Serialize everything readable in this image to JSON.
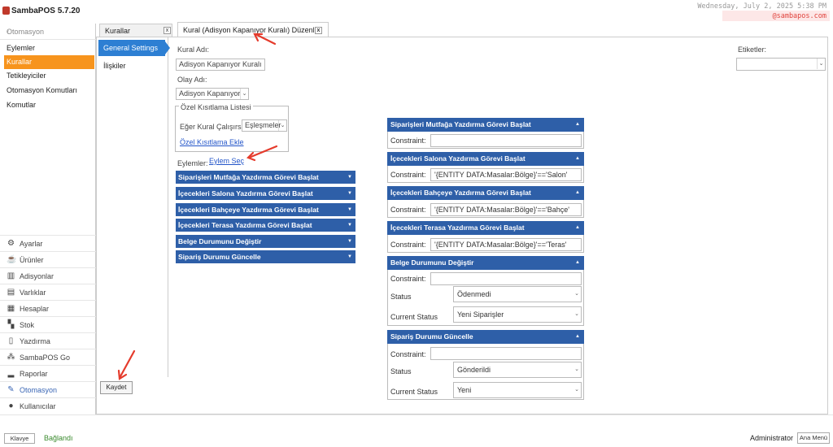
{
  "app": {
    "title": "SambaPOS 5.7.20"
  },
  "header": {
    "datetime": "Wednesday, July 2, 2025 5:38 PM",
    "watermark": "@sambapos.com"
  },
  "sidebar": {
    "header": "Otomasyon",
    "collapse_glyph": "‹",
    "items": [
      {
        "label": "Eylemler",
        "active": false
      },
      {
        "label": "Kurallar",
        "active": true
      },
      {
        "label": "Tetikleyiciler",
        "active": false
      },
      {
        "label": "Otomasyon Komutları",
        "active": false
      },
      {
        "label": "Komutlar",
        "active": false
      }
    ],
    "bottom": [
      {
        "label": "Ayarlar",
        "icon": "gear-icon"
      },
      {
        "label": "Ürünler",
        "icon": "cup-icon"
      },
      {
        "label": "Adisyonlar",
        "icon": "books-icon"
      },
      {
        "label": "Varlıklar",
        "icon": "list-icon"
      },
      {
        "label": "Hesaplar",
        "icon": "calculator-icon"
      },
      {
        "label": "Stok",
        "icon": "boxes-icon"
      },
      {
        "label": "Yazdırma",
        "icon": "document-icon"
      },
      {
        "label": "SambaPOS Go",
        "icon": "network-icon"
      },
      {
        "label": "Raporlar",
        "icon": "bar-chart-icon"
      },
      {
        "label": "Otomasyon",
        "icon": "pen-icon",
        "active": true
      },
      {
        "label": "Kullanıcılar",
        "icon": "user-icon"
      }
    ]
  },
  "tabs": {
    "outer": "Kurallar",
    "inner": "Kural (Adisyon Kapanıyor Kuralı) Düzenle",
    "close_glyph": "x"
  },
  "settings_nav": {
    "general": "General Settings",
    "relations": "İlişkiler"
  },
  "form": {
    "rule_name_label": "Kural Adı:",
    "rule_name_value": "Adisyon Kapanıyor Kuralı",
    "event_label": "Olay Adı:",
    "event_value": "Adisyon Kapanıyor",
    "constraint_list_label": "Özel Kısıtlama Listesi",
    "run_if_label": "Eğer Kural Çalışırsa",
    "run_if_value": "Eşleşmeler",
    "add_constraint_link": "Özel Kısıtlama Ekle",
    "actions_label": "Eylemler:",
    "select_action_link": "Eylem Seç",
    "tags_label": "Etiketler:"
  },
  "actions": [
    "Siparişleri Mutfağa Yazdırma Görevi Başlat",
    "İçecekleri Salona Yazdırma Görevi Başlat",
    "İçecekleri Bahçeye Yazdırma Görevi Başlat",
    "İçecekleri Terasa Yazdırma Görevi Başlat",
    "Belge Durumunu Değiştir",
    "Sipariş Durumu Güncelle"
  ],
  "panels": [
    {
      "title": "Siparişleri Mutfağa Yazdırma Görevi Başlat",
      "constraint_label": "Constraint:",
      "constraint": ""
    },
    {
      "title": "İçecekleri Salona Yazdırma Görevi Başlat",
      "constraint_label": "Constraint:",
      "constraint": "'{ENTITY DATA:Masalar:Bölge}'=='Salon'"
    },
    {
      "title": "İçecekleri Bahçeye Yazdırma Görevi Başlat",
      "constraint_label": "Constraint:",
      "constraint": "'{ENTITY DATA:Masalar:Bölge}'=='Bahçe'"
    },
    {
      "title": "İçecekleri Terasa Yazdırma Görevi Başlat",
      "constraint_label": "Constraint:",
      "constraint": "'{ENTITY DATA:Masalar:Bölge}'=='Teras'"
    },
    {
      "title": "Belge Durumunu Değiştir",
      "constraint_label": "Constraint:",
      "constraint": "",
      "status_label": "Status",
      "status": "Ödenmedi",
      "current_status_label": "Current Status",
      "current_status": "Yeni Siparişler"
    },
    {
      "title": "Sipariş Durumu Güncelle",
      "constraint_label": "Constraint:",
      "constraint": "",
      "status_label": "Status",
      "status": "Gönderildi",
      "current_status_label": "Current Status",
      "current_status": "Yeni"
    }
  ],
  "footer": {
    "save": "Kaydet",
    "keyboard": "Klavye",
    "connection": "Bağlandı",
    "user": "Administrator",
    "main_menu": "Ana Menü"
  },
  "colors": {
    "accent": "#f7941d",
    "header_blue": "#2e5fa8",
    "tab_blue": "#2d7fd3",
    "annotation": "#e53b2c"
  }
}
